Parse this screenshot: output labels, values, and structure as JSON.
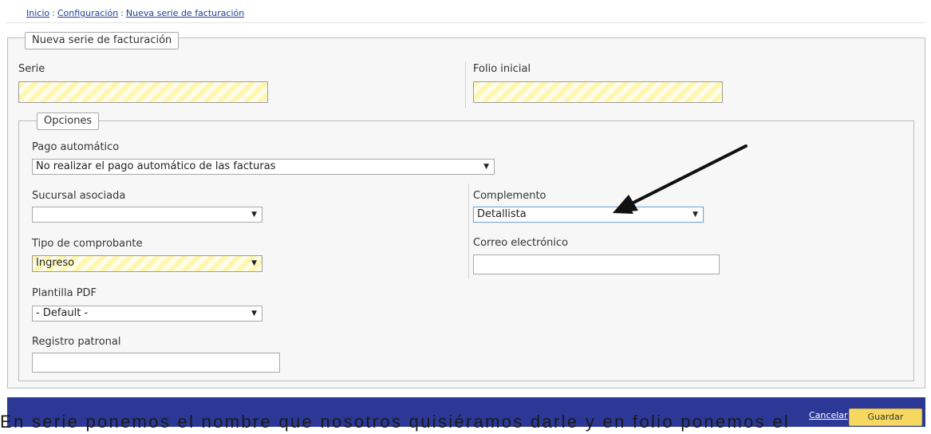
{
  "breadcrumb": {
    "items": [
      "Inicio",
      "Configuración",
      "Nueva serie de facturación"
    ],
    "separator": ":"
  },
  "form": {
    "title": "Nueva serie de facturación",
    "serie_label": "Serie",
    "serie_value": "",
    "folio_label": "Folio inicial",
    "folio_value": ""
  },
  "options": {
    "title": "Opciones",
    "pago_label": "Pago automático",
    "pago_value": "No realizar el pago automático de las facturas",
    "sucursal_label": "Sucursal asociada",
    "sucursal_value": "",
    "complemento_label": "Complemento",
    "complemento_value": "Detallista",
    "tipo_label": "Tipo de comprobante",
    "tipo_value": "Ingreso",
    "correo_label": "Correo electrónico",
    "correo_value": "",
    "plantilla_label": "Plantilla PDF",
    "plantilla_value": "- Default -",
    "registro_label": "Registro patronal",
    "registro_value": ""
  },
  "footer": {
    "cancel_label": "Cancelar",
    "save_label": "Guardar"
  },
  "caption": "En serie ponemos el nombre que nosotros quisiéramos darle y en folio ponemos el",
  "colors": {
    "footer_bar": "#2b3896",
    "save_button": "#f6d860",
    "required_field": "#fffbd3"
  }
}
